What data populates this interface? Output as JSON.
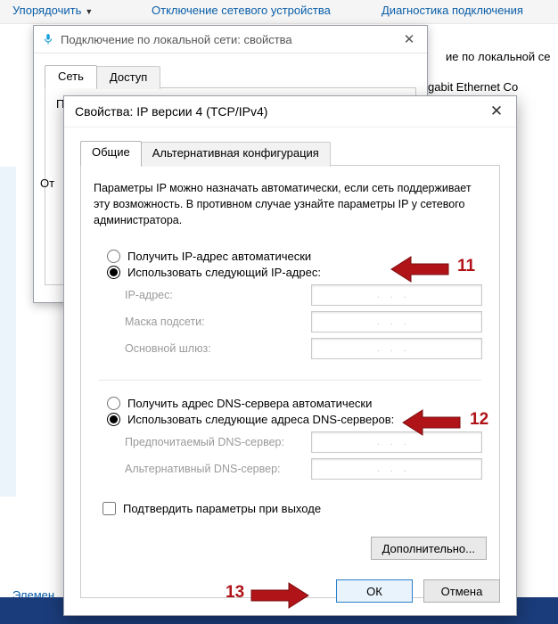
{
  "background": {
    "toolbar": {
      "organize": "Упорядочить",
      "disable": "Отключение сетевого устройства",
      "diagnose": "Диагностика подключения"
    },
    "right_snippet1": "ие по локальной се",
    "right_snippet2": "Gigabit Ethernet Co",
    "elements": "Элемен"
  },
  "lan_window": {
    "title": "Подключение по локальной сети: свойства",
    "tabs": {
      "network": "Сеть",
      "access": "Доступ"
    },
    "connection_label": "По",
    "side_label": "От"
  },
  "dialog": {
    "title": "Свойства: IP версии 4 (TCP/IPv4)",
    "tabs": {
      "general": "Общие",
      "alt": "Альтернативная конфигурация"
    },
    "description": "Параметры IP можно назначать автоматически, если сеть поддерживает эту возможность. В противном случае узнайте параметры IP у сетевого администратора.",
    "ip": {
      "auto": "Получить IP-адрес автоматически",
      "manual": "Использовать следующий IP-адрес:",
      "addr_label": "IP-адрес:",
      "mask_label": "Маска подсети:",
      "gw_label": "Основной шлюз:"
    },
    "dns": {
      "auto": "Получить адрес DNS-сервера автоматически",
      "manual": "Использовать следующие адреса DNS-серверов:",
      "pref_label": "Предпочитаемый DNS-сервер:",
      "alt_label": "Альтернативный DNS-сервер:"
    },
    "validate": "Подтвердить параметры при выходе",
    "advanced": "Дополнительно...",
    "ok": "ОК",
    "cancel": "Отмена"
  },
  "annotations": {
    "n11": "11",
    "n12": "12",
    "n13": "13"
  },
  "colors": {
    "annotation": "#b01418",
    "link": "#0a5ea8"
  },
  "ip_dots": "..."
}
